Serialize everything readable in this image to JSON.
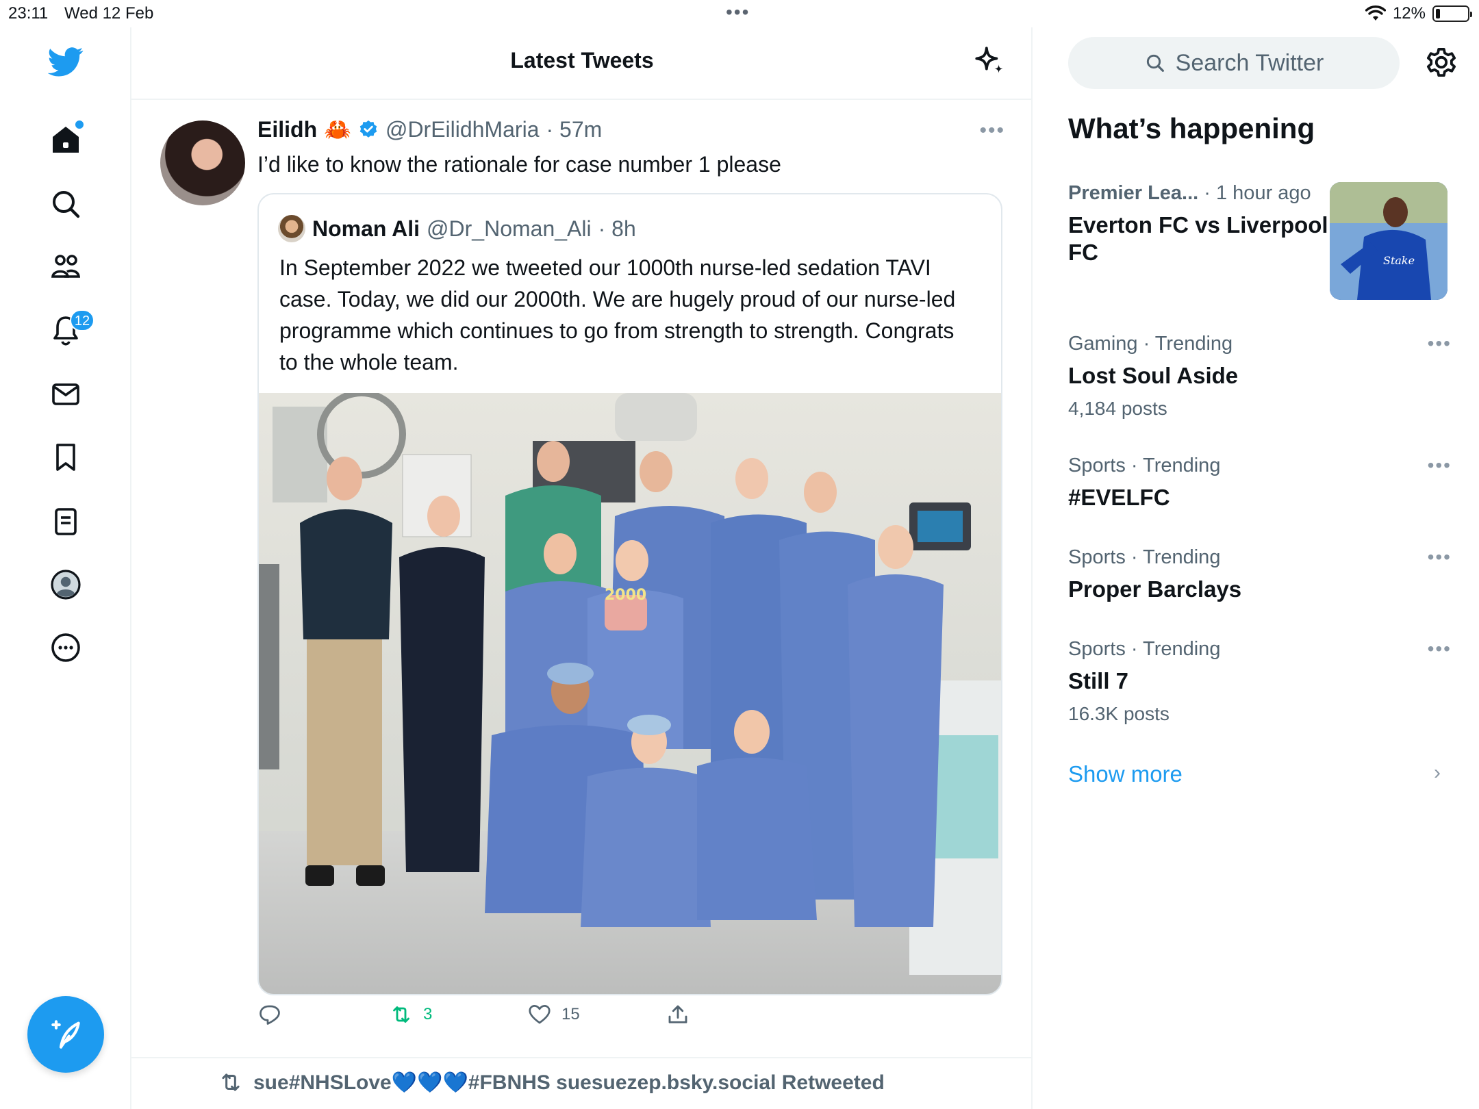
{
  "status_bar": {
    "time": "23:11",
    "date": "Wed 12 Feb",
    "battery": "12%"
  },
  "nav": {
    "notifications_badge": "12"
  },
  "header": {
    "title": "Latest Tweets"
  },
  "tweet": {
    "author_name": "Eilidh",
    "author_emoji": "🦀",
    "handle": "@DrEilidhMaria",
    "time": "· 57m",
    "text": "I’d like to know the rationale for case number 1 please",
    "quote": {
      "author_name": "Noman Ali",
      "handle": "@Dr_Noman_Ali",
      "time": "· 8h",
      "text": "In September 2022 we tweeted our 1000th nurse-led sedation TAVI case. Today, we did our 2000th. We are hugely proud of our nurse-led programme which continues to go from strength to strength. Congrats to the whole team.",
      "cake_label": "2000"
    },
    "retweet_count": "3",
    "like_count": "15"
  },
  "next_tweet": {
    "retweeted_by": "sue#NHSLove💙💙💙#FBNHS suesuezep.bsky.social Retweeted"
  },
  "sidebar": {
    "search_placeholder": "Search Twitter",
    "section_title": "What’s happening",
    "trends": [
      {
        "category": "Premier Lea...",
        "time": "· 1 hour ago",
        "title": "Everton FC vs Liverpool FC"
      },
      {
        "category": "Gaming · Trending",
        "title": "Lost Soul Aside",
        "count": "4,184 posts"
      },
      {
        "category": "Sports · Trending",
        "title": "#EVELFC"
      },
      {
        "category": "Sports · Trending",
        "title": "Proper Barclays"
      },
      {
        "category": "Sports · Trending",
        "title": "Still 7",
        "count": "16.3K posts"
      }
    ],
    "show_more": "Show more"
  },
  "colors": {
    "accent": "#1d9bf0",
    "retweet_green": "#00ba7c",
    "muted": "#536471"
  }
}
